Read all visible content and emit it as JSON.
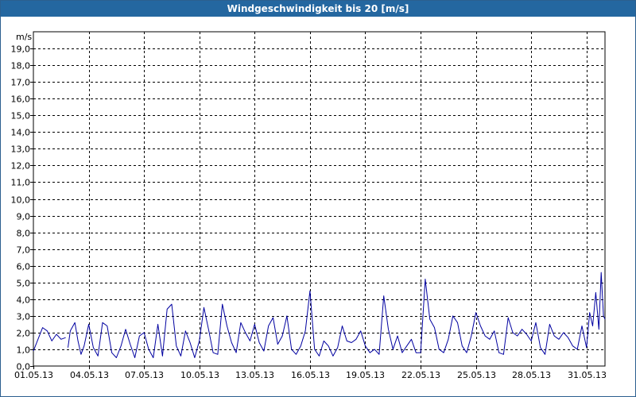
{
  "window": {
    "title": "Windgeschwindigkeit bis 20 [m/s]"
  },
  "colors": {
    "titlebar": "#2467a0",
    "series": "#0000a0",
    "grid": "#000000"
  },
  "chart_data": {
    "type": "line",
    "title": "Windgeschwindigkeit bis 20 [m/s]",
    "ylabel": "m/s",
    "xlabel": "",
    "ylim": [
      0,
      20
    ],
    "xlim": [
      "2013-05-01",
      "2013-06-01"
    ],
    "yticks": [
      "0,0",
      "1,0",
      "2,0",
      "3,0",
      "4,0",
      "5,0",
      "6,0",
      "7,0",
      "8,0",
      "9,0",
      "10,0",
      "11,0",
      "12,0",
      "13,0",
      "14,0",
      "15,0",
      "16,0",
      "17,0",
      "18,0",
      "19,0"
    ],
    "xticks": [
      "01.05.13",
      "04.05.13",
      "07.05.13",
      "10.05.13",
      "13.05.13",
      "16.05.13",
      "19.05.13",
      "22.05.13",
      "25.05.13",
      "28.05.13",
      "31.05.13"
    ],
    "grid": true,
    "legend": "none",
    "series": [
      {
        "segments": [
          {
            "x": [
              "2013-05-01 00:00",
              "2013-05-01 06:00",
              "2013-05-01 12:00",
              "2013-05-01 18:00",
              "2013-05-02 00:00",
              "2013-05-02 06:00",
              "2013-05-02 12:00",
              "2013-05-02 18:00"
            ],
            "y": [
              0.9,
              1.6,
              2.3,
              2.1,
              1.5,
              1.9,
              1.6,
              1.7
            ]
          },
          {
            "x": [
              "2013-05-02 21:00",
              "2013-05-03 00:00",
              "2013-05-03 06:00",
              "2013-05-03 10:00",
              "2013-05-03 14:00",
              "2013-05-03 18:00",
              "2013-05-04 00:00",
              "2013-05-04 06:00",
              "2013-05-04 12:00",
              "2013-05-04 18:00",
              "2013-05-05 00:00",
              "2013-05-05 06:00",
              "2013-05-05 12:00",
              "2013-05-05 18:00",
              "2013-05-06 00:00",
              "2013-05-06 06:00",
              "2013-05-06 12:00",
              "2013-05-06 18:00",
              "2013-05-07 00:00",
              "2013-05-07 06:00",
              "2013-05-07 12:00",
              "2013-05-07 18:00",
              "2013-05-08 00:00",
              "2013-05-08 06:00",
              "2013-05-08 12:00",
              "2013-05-08 18:00",
              "2013-05-09 00:00",
              "2013-05-09 06:00",
              "2013-05-09 12:00",
              "2013-05-09 18:00",
              "2013-05-10 00:00",
              "2013-05-10 06:00",
              "2013-05-10 12:00",
              "2013-05-10 18:00",
              "2013-05-11 00:00",
              "2013-05-11 06:00",
              "2013-05-11 12:00",
              "2013-05-11 18:00",
              "2013-05-12 00:00",
              "2013-05-12 06:00",
              "2013-05-12 12:00",
              "2013-05-12 18:00",
              "2013-05-13 00:00",
              "2013-05-13 06:00",
              "2013-05-13 12:00",
              "2013-05-13 18:00",
              "2013-05-14 00:00",
              "2013-05-14 06:00",
              "2013-05-14 12:00",
              "2013-05-14 18:00",
              "2013-05-15 00:00",
              "2013-05-15 06:00",
              "2013-05-15 12:00",
              "2013-05-15 18:00",
              "2013-05-16 00:00",
              "2013-05-16 06:00",
              "2013-05-16 12:00",
              "2013-05-16 18:00",
              "2013-05-17 00:00",
              "2013-05-17 06:00",
              "2013-05-17 12:00",
              "2013-05-17 18:00",
              "2013-05-18 00:00",
              "2013-05-18 06:00",
              "2013-05-18 12:00",
              "2013-05-18 18:00",
              "2013-05-19 00:00",
              "2013-05-19 06:00",
              "2013-05-19 12:00",
              "2013-05-19 18:00",
              "2013-05-20 00:00",
              "2013-05-20 06:00",
              "2013-05-20 12:00",
              "2013-05-20 18:00",
              "2013-05-21 00:00",
              "2013-05-21 06:00",
              "2013-05-21 12:00",
              "2013-05-21 18:00",
              "2013-05-22 00:00",
              "2013-05-22 06:00",
              "2013-05-22 12:00",
              "2013-05-22 18:00",
              "2013-05-23 00:00",
              "2013-05-23 06:00",
              "2013-05-23 12:00",
              "2013-05-23 18:00",
              "2013-05-24 00:00",
              "2013-05-24 06:00",
              "2013-05-24 12:00",
              "2013-05-24 18:00",
              "2013-05-25 00:00",
              "2013-05-25 06:00",
              "2013-05-25 12:00",
              "2013-05-25 18:00",
              "2013-05-26 00:00",
              "2013-05-26 06:00",
              "2013-05-26 12:00",
              "2013-05-26 18:00",
              "2013-05-27 00:00",
              "2013-05-27 06:00",
              "2013-05-27 12:00",
              "2013-05-27 18:00",
              "2013-05-28 00:00",
              "2013-05-28 06:00",
              "2013-05-28 12:00",
              "2013-05-28 18:00",
              "2013-05-29 00:00",
              "2013-05-29 06:00",
              "2013-05-29 12:00",
              "2013-05-29 18:00",
              "2013-05-30 00:00",
              "2013-05-30 06:00",
              "2013-05-30 12:00",
              "2013-05-30 18:00",
              "2013-05-31 00:00",
              "2013-05-31 04:00",
              "2013-05-31 08:00",
              "2013-05-31 12:00",
              "2013-05-31 16:00",
              "2013-05-31 19:00",
              "2013-05-31 22:00",
              "2013-06-01 00:00"
            ],
            "y": [
              1.1,
              2.1,
              2.6,
              1.5,
              0.7,
              1.2,
              2.5,
              1.1,
              0.6,
              2.6,
              2.4,
              0.8,
              0.5,
              1.2,
              2.2,
              1.3,
              0.5,
              1.8,
              2.0,
              1.0,
              0.5,
              2.5,
              0.6,
              3.4,
              3.7,
              1.2,
              0.6,
              2.1,
              1.4,
              0.5,
              1.5,
              3.5,
              2.2,
              0.8,
              0.7,
              3.7,
              2.4,
              1.4,
              0.8,
              2.6,
              2.0,
              1.5,
              2.5,
              1.4,
              0.9,
              2.4,
              2.9,
              1.3,
              1.8,
              3.0,
              1.0,
              0.7,
              1.2,
              2.1,
              4.5,
              1.0,
              0.6,
              1.5,
              1.2,
              0.6,
              1.1,
              2.4,
              1.5,
              1.4,
              1.6,
              2.1,
              1.2,
              0.8,
              1.0,
              0.7,
              4.2,
              2.2,
              1.0,
              1.8,
              0.8,
              1.2,
              1.6,
              0.8,
              0.8,
              5.2,
              2.8,
              2.3,
              1.0,
              0.8,
              1.6,
              3.0,
              2.6,
              1.2,
              0.8,
              1.8,
              3.2,
              2.4,
              1.8,
              1.6,
              2.1,
              0.8,
              0.7,
              2.9,
              2.0,
              1.8,
              2.2,
              1.9,
              1.5,
              2.6,
              1.1,
              0.7,
              2.5,
              1.8,
              1.6,
              2.0,
              1.7,
              1.2,
              1.0,
              2.4,
              1.1,
              3.2,
              2.4,
              4.4,
              2.2,
              5.6,
              3.0,
              2.8
            ]
          }
        ]
      }
    ]
  }
}
